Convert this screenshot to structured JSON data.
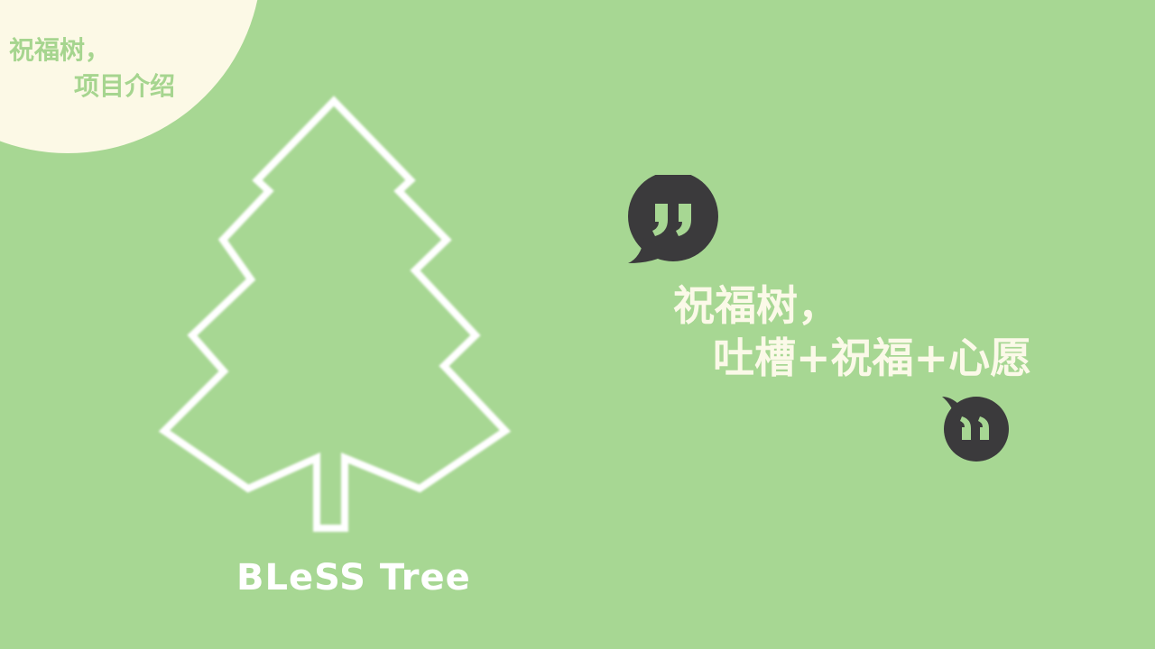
{
  "slide": {
    "background_color": "#a7d793",
    "corner": {
      "color": "#fcf9e6",
      "title_line1": "祝福树，",
      "title_line2": "项目介绍"
    },
    "tree": {
      "icon": "pine-tree-outline-icon",
      "label": "BLeSS Tree"
    },
    "quote": {
      "open_icon": "quote-open-bubble-icon",
      "close_icon": "quote-close-bubble-icon",
      "bubble_color": "#3b3a3c",
      "line1": "祝福树，",
      "line2": "吐槽+祝福+心愿"
    }
  }
}
